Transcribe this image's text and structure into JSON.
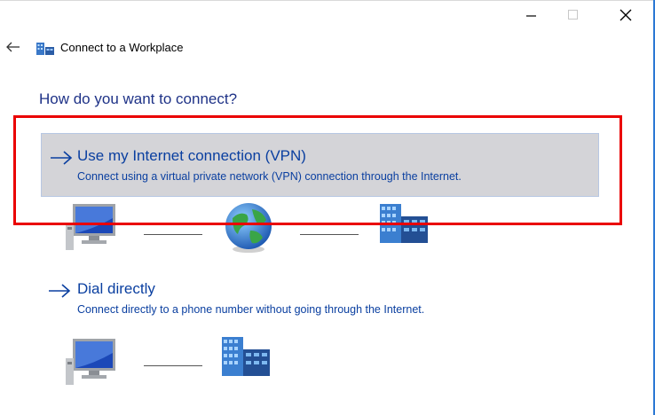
{
  "window": {
    "title": "Connect to a Workplace",
    "minimize_glyph": "—",
    "close_glyph": "✕"
  },
  "page": {
    "heading": "How do you want to connect?"
  },
  "options": [
    {
      "title": "Use my Internet connection (VPN)",
      "description": "Connect using a virtual private network (VPN) connection through the Internet.",
      "arrow": "→"
    },
    {
      "title": "Dial directly",
      "description": "Connect directly to a phone number without going through the Internet.",
      "arrow": "→"
    }
  ],
  "colors": {
    "heading": "#1e3287",
    "link": "#0a3fa0",
    "highlight_border": "#ea0000",
    "selected_option_bg": "#d4d4d8"
  },
  "icons": {
    "back": "back-arrow-icon",
    "app": "workplace-network-icon",
    "computer": "computer-icon",
    "globe": "globe-icon",
    "building": "office-building-icon"
  }
}
